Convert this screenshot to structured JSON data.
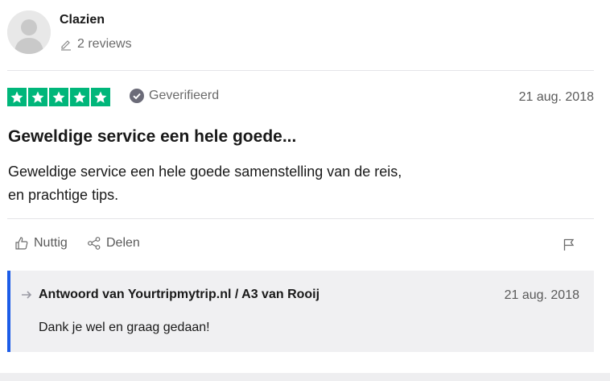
{
  "reviewer": {
    "name": "Clazien",
    "review_count": "2 reviews"
  },
  "rating": {
    "stars": 5,
    "max": 5,
    "color": "#00b67a",
    "verified_label": "Geverifieerd",
    "date": "21 aug. 2018"
  },
  "review": {
    "title": "Geweldige service een hele goede...",
    "body_lines": [
      "Geweldige service een hele goede samenstelling van de reis,",
      "en prachtige tips."
    ]
  },
  "actions": {
    "useful_label": "Nuttig",
    "share_label": "Delen",
    "icons": [
      "thumbs-up-icon",
      "share-icon",
      "flag-icon"
    ]
  },
  "reply": {
    "title": "Antwoord van Yourtripmytrip.nl / A3 van Rooij",
    "date": "21 aug. 2018",
    "text": "Dank je wel en graag gedaan!",
    "accent_color": "#1c5ce8"
  }
}
